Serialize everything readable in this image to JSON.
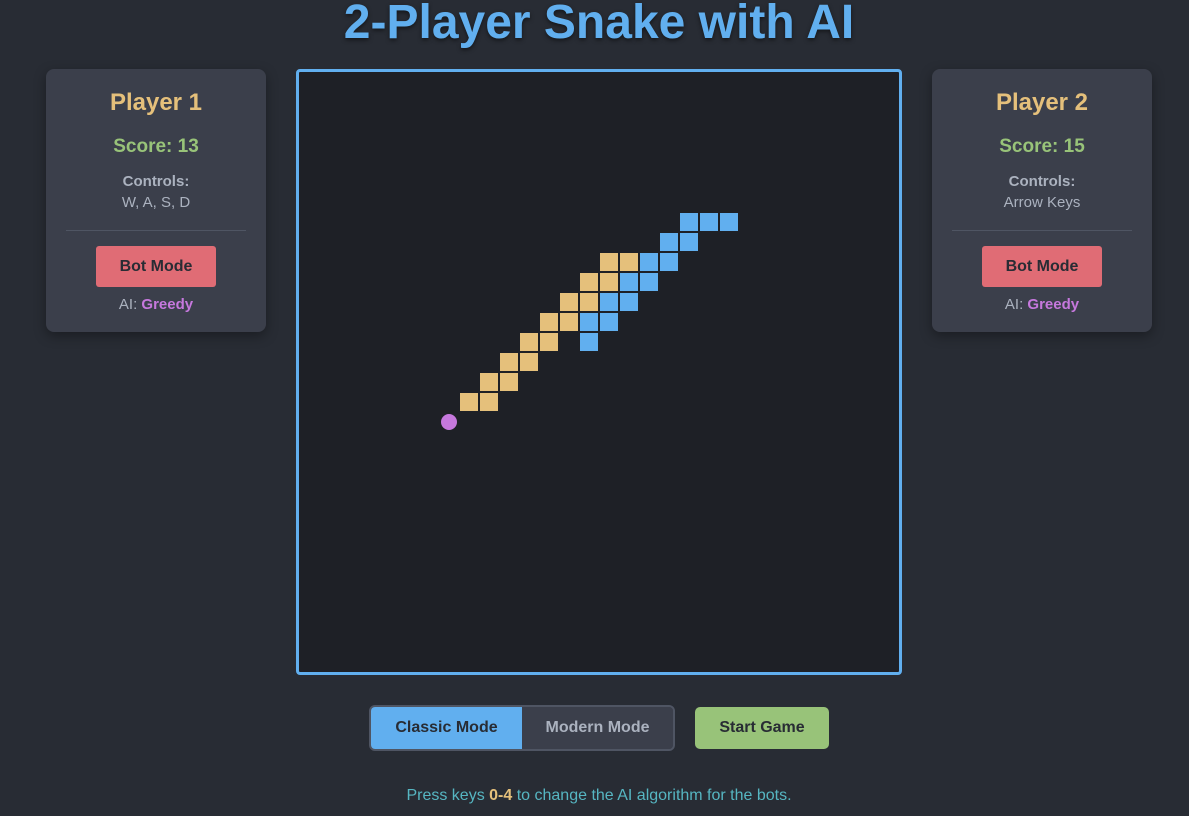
{
  "title": "2-Player Snake with AI",
  "players": [
    {
      "name": "Player 1",
      "score": "Score: 13",
      "controls_label": "Controls:",
      "controls_keys": "W, A, S, D",
      "bot_button": "Bot Mode",
      "ai_prefix": "AI:",
      "ai_algorithm": "Greedy"
    },
    {
      "name": "Player 2",
      "score": "Score: 15",
      "controls_label": "Controls:",
      "controls_keys": "Arrow Keys",
      "bot_button": "Bot Mode",
      "ai_prefix": "AI:",
      "ai_algorithm": "Greedy"
    }
  ],
  "board": {
    "grid_size": 30,
    "colors": {
      "player1": "#e5c07b",
      "player2": "#61afef",
      "food": "#c678dd",
      "background": "#1e2026",
      "border": "#61afef"
    },
    "snake1_cells": [
      [
        8,
        16
      ],
      [
        9,
        16
      ],
      [
        9,
        15
      ],
      [
        10,
        15
      ],
      [
        10,
        14
      ],
      [
        11,
        14
      ],
      [
        11,
        13
      ],
      [
        12,
        13
      ],
      [
        12,
        12
      ],
      [
        13,
        12
      ],
      [
        13,
        11
      ],
      [
        14,
        11
      ],
      [
        14,
        10
      ],
      [
        15,
        10
      ],
      [
        15,
        9
      ],
      [
        16,
        9
      ]
    ],
    "snake2_cells": [
      [
        14,
        13
      ],
      [
        14,
        12
      ],
      [
        15,
        12
      ],
      [
        15,
        11
      ],
      [
        16,
        11
      ],
      [
        16,
        10
      ],
      [
        17,
        10
      ],
      [
        17,
        9
      ],
      [
        18,
        9
      ],
      [
        18,
        8
      ],
      [
        19,
        8
      ],
      [
        19,
        7
      ],
      [
        20,
        7
      ],
      [
        21,
        7
      ]
    ],
    "food_cell": [
      7,
      17
    ]
  },
  "modes": {
    "classic": "Classic Mode",
    "modern": "Modern Mode",
    "active": "classic"
  },
  "start_button": "Start Game",
  "hint": {
    "before": "Press keys ",
    "keys": "0-4",
    "after": " to change the AI algorithm for the bots."
  }
}
